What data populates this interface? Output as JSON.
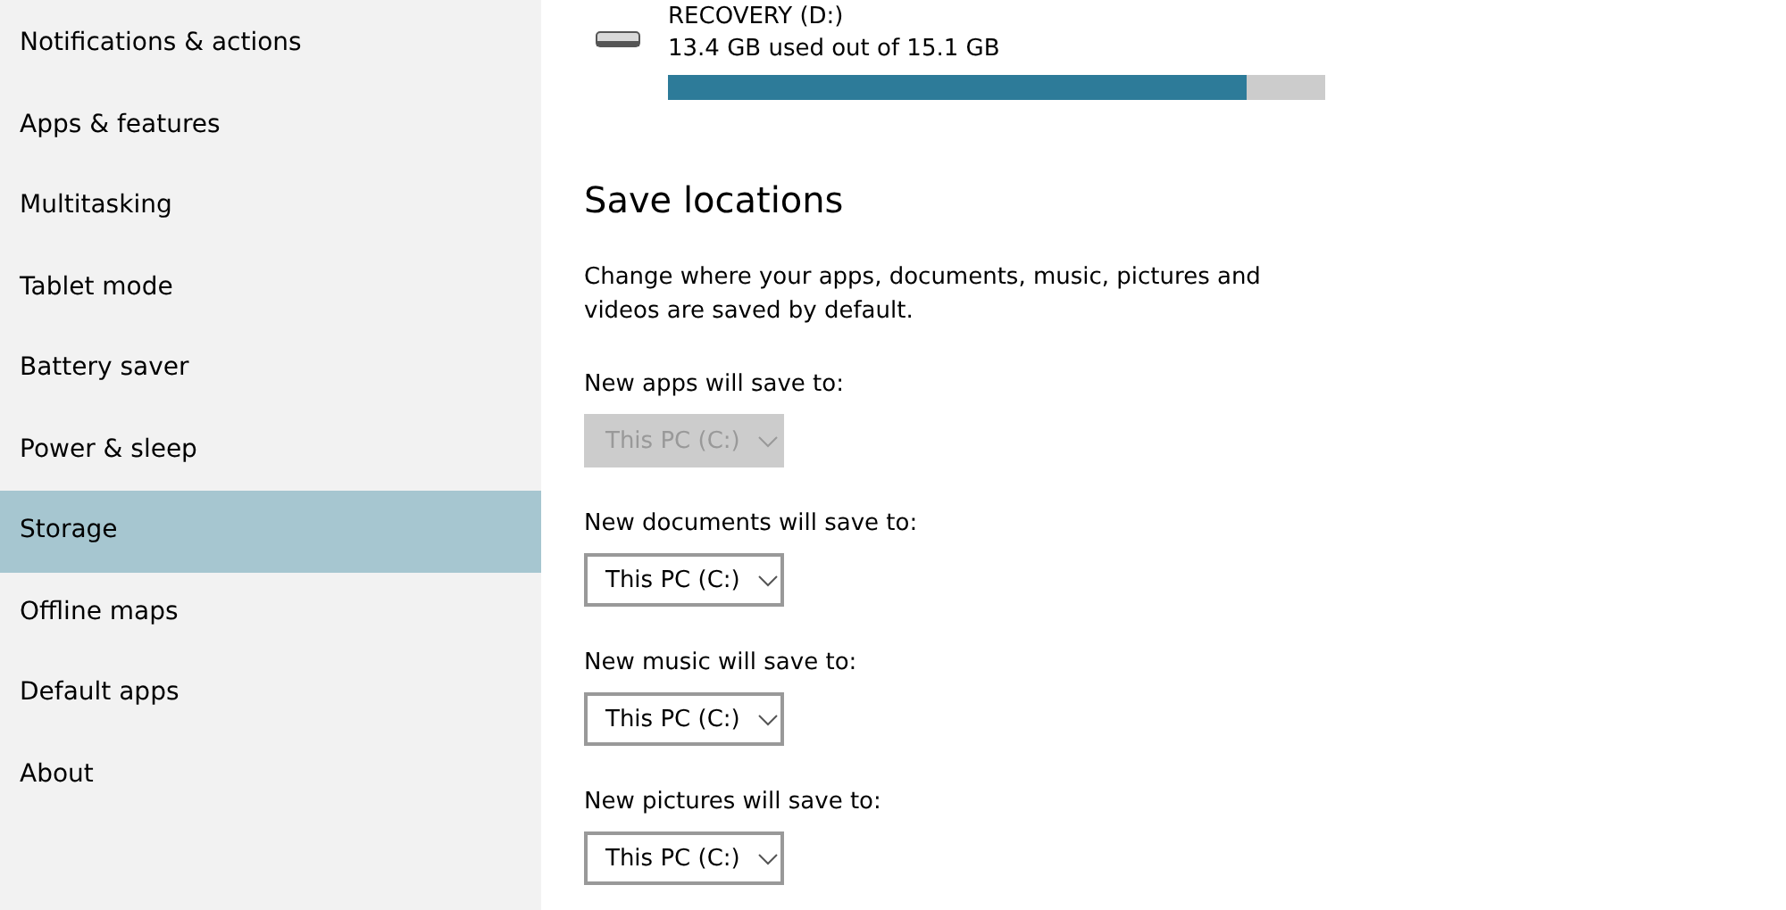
{
  "sidebar": {
    "items": [
      {
        "label": "Notifications & actions",
        "selected": false
      },
      {
        "label": "Apps & features",
        "selected": false
      },
      {
        "label": "Multitasking",
        "selected": false
      },
      {
        "label": "Tablet mode",
        "selected": false
      },
      {
        "label": "Battery saver",
        "selected": false
      },
      {
        "label": "Power & sleep",
        "selected": false
      },
      {
        "label": "Storage",
        "selected": true
      },
      {
        "label": "Offline maps",
        "selected": false
      },
      {
        "label": "Default apps",
        "selected": false
      },
      {
        "label": "About",
        "selected": false
      }
    ]
  },
  "drive": {
    "name": "RECOVERY (D:)",
    "usage": "13.4 GB used out of 15.1 GB",
    "level": 0.88
  },
  "save_locations": {
    "heading": "Save locations",
    "description": "Change where your apps, documents, music, pictures and videos are saved by default.",
    "settings": [
      {
        "label": "New apps will save to:",
        "value": "This PC (C:)",
        "disabled": true
      },
      {
        "label": "New documents will save to:",
        "value": "This PC (C:)",
        "disabled": false
      },
      {
        "label": "New music will save to:",
        "value": "This PC (C:)",
        "disabled": false
      },
      {
        "label": "New pictures will save to:",
        "value": "This PC (C:)",
        "disabled": false
      }
    ]
  }
}
